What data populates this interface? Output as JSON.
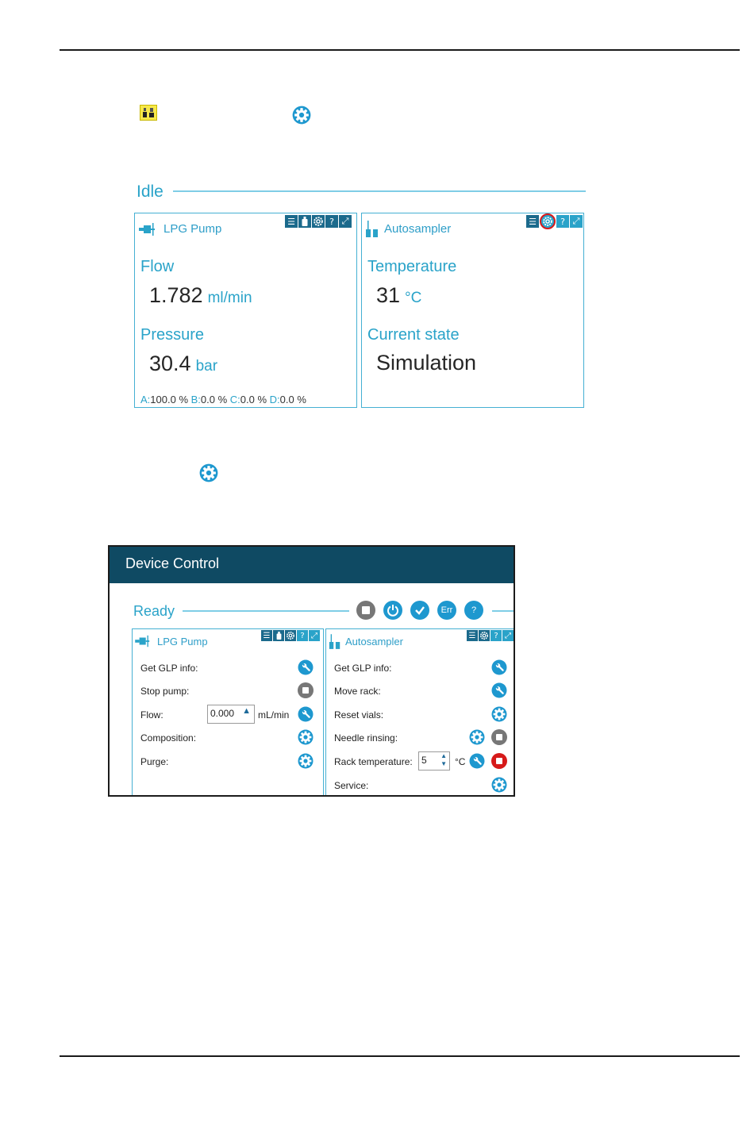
{
  "idle": {
    "status": "Idle",
    "pump": {
      "title": "LPG Pump",
      "flow_label": "Flow",
      "flow_value": "1.782",
      "flow_unit": "ml/min",
      "pressure_label": "Pressure",
      "pressure_value": "30.4",
      "pressure_unit": "bar",
      "composition": [
        {
          "label": "A:",
          "value": "100.0 %"
        },
        {
          "label": "B:",
          "value": "0.0 %"
        },
        {
          "label": "C:",
          "value": "0.0 %"
        },
        {
          "label": "D:",
          "value": "0.0 %"
        }
      ]
    },
    "autosampler": {
      "title": "Autosampler",
      "temperature_label": "Temperature",
      "temperature_value": "31",
      "temperature_unit": "°C",
      "state_label": "Current state",
      "state_value": "Simulation"
    },
    "toolbar_glyphs": {
      "menu": "☰",
      "help": "?",
      "expand": "⤢"
    }
  },
  "device_control": {
    "title": "Device Control",
    "status": "Ready",
    "status_buttons": {
      "err": "Err",
      "help": "?"
    },
    "pump": {
      "title": "LPG Pump",
      "rows": {
        "glp": "Get GLP info:",
        "stop": "Stop pump:",
        "flow": "Flow:",
        "composition": "Composition:",
        "purge": "Purge:"
      },
      "flow_value": "0.000",
      "flow_unit": "mL/min"
    },
    "autosampler": {
      "title": "Autosampler",
      "rows": {
        "glp": "Get GLP info:",
        "move_rack": "Move rack:",
        "reset_vials": "Reset vials:",
        "needle_rinsing": "Needle rinsing:",
        "rack_temperature": "Rack temperature:",
        "service": "Service:"
      },
      "rack_temp_value": "5",
      "rack_temp_unit": "°C"
    }
  },
  "colors": {
    "accent": "#2aa3c9",
    "header": "#0f4a63",
    "stop_red": "#d61a1a",
    "grey": "#777777"
  },
  "icons": [
    "config-icon",
    "gear-icon",
    "pump-icon",
    "autosampler-icon",
    "wrench-icon",
    "stop-icon",
    "power-icon",
    "check-icon"
  ]
}
